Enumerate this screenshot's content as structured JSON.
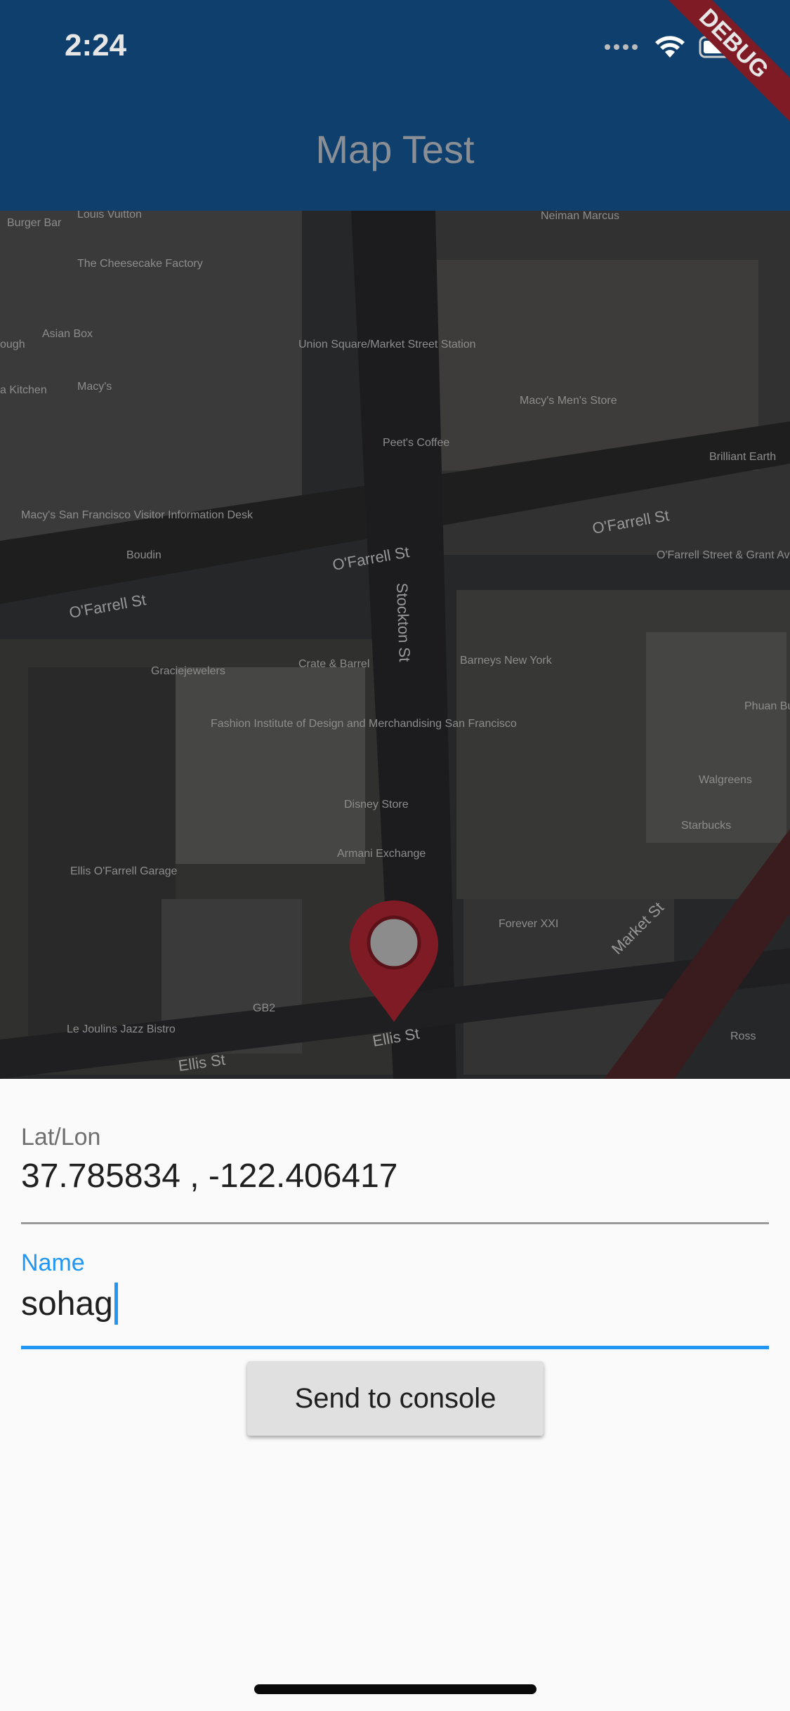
{
  "status_bar": {
    "time": "2:24",
    "icons": [
      "cellular-icon",
      "wifi-icon",
      "battery-icon"
    ]
  },
  "app_bar": {
    "title": "Map Test",
    "debug_banner": "DEBUG"
  },
  "map": {
    "labels": [
      "Burger Bar",
      "Louis Vuitton",
      "Neiman Marcus",
      "The Cheesecake Factory",
      "Asian Box",
      "ough",
      "Union Square/Market Street Station",
      "Macy's",
      "a Kitchen",
      "Macy's Men's Store",
      "Peet's Coffee",
      "Brilliant Earth",
      "Macy's San Francisco Visitor Information Desk",
      "Boudin",
      "O'Farrell St",
      "O'Farrell St",
      "O'Farrell St",
      "O'Farrell Street & Grant Avenue",
      "Stockton St",
      "Crate & Barrel",
      "Barneys New York",
      "Graciejewelers",
      "Fashion Institute of Design and Merchandising San Francisco",
      "Disney Store",
      "Armani Exchange",
      "Phuan Build",
      "Walgreens",
      "Starbucks",
      "Ellis O'Farrell Garage",
      "Forever XXI",
      "Market St",
      "GB2",
      "Le Joulins Jazz Bistro",
      "Ellis St",
      "Ellis St",
      "Ross"
    ]
  },
  "form": {
    "latlon_label": "Lat/Lon",
    "latlon_value": "37.785834 , -122.406417",
    "name_label": "Name",
    "name_value": "sohag",
    "send_button": "Send to console"
  },
  "colors": {
    "app_bar": "#0f3f6c",
    "accent": "#2196f3",
    "pin": "#7f1b25"
  }
}
